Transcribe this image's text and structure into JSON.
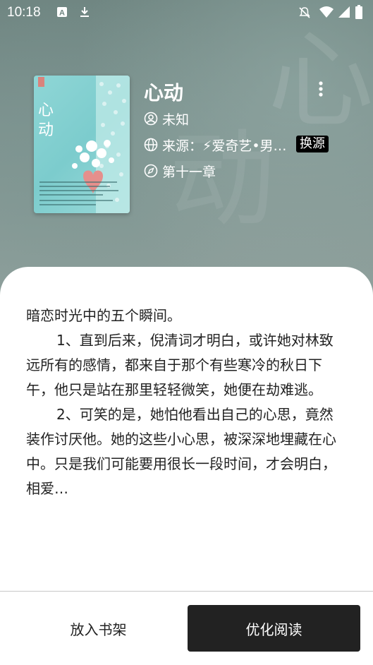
{
  "status_bar": {
    "time": "10:18"
  },
  "book": {
    "title": "心动",
    "cover_title": "心动",
    "author": "未知",
    "source": "来源：⚡爱奇艺•男…",
    "switch_source_label": "换源",
    "chapter": "第十一章"
  },
  "intro": {
    "line1": "暗恋时光中的五个瞬间。",
    "para1": "1、直到后来，倪清词才明白，或许她对林致远所有的感情，都来自于那个有些寒冷的秋日下午，他只是站在那里轻轻微笑，她便在劫难逃。",
    "para2": "2、可笑的是，她怕他看出自己的心思，竟然装作讨厌他。她的这些小心思，被深深地埋藏在心中。只是我们可能要用很长一段时间，才会明白，相爱…"
  },
  "actions": {
    "add_to_shelf": "放入书架",
    "optimize_read": "优化阅读"
  },
  "colors": {
    "accent_button": "#222222",
    "cover": "#7ccccd"
  }
}
